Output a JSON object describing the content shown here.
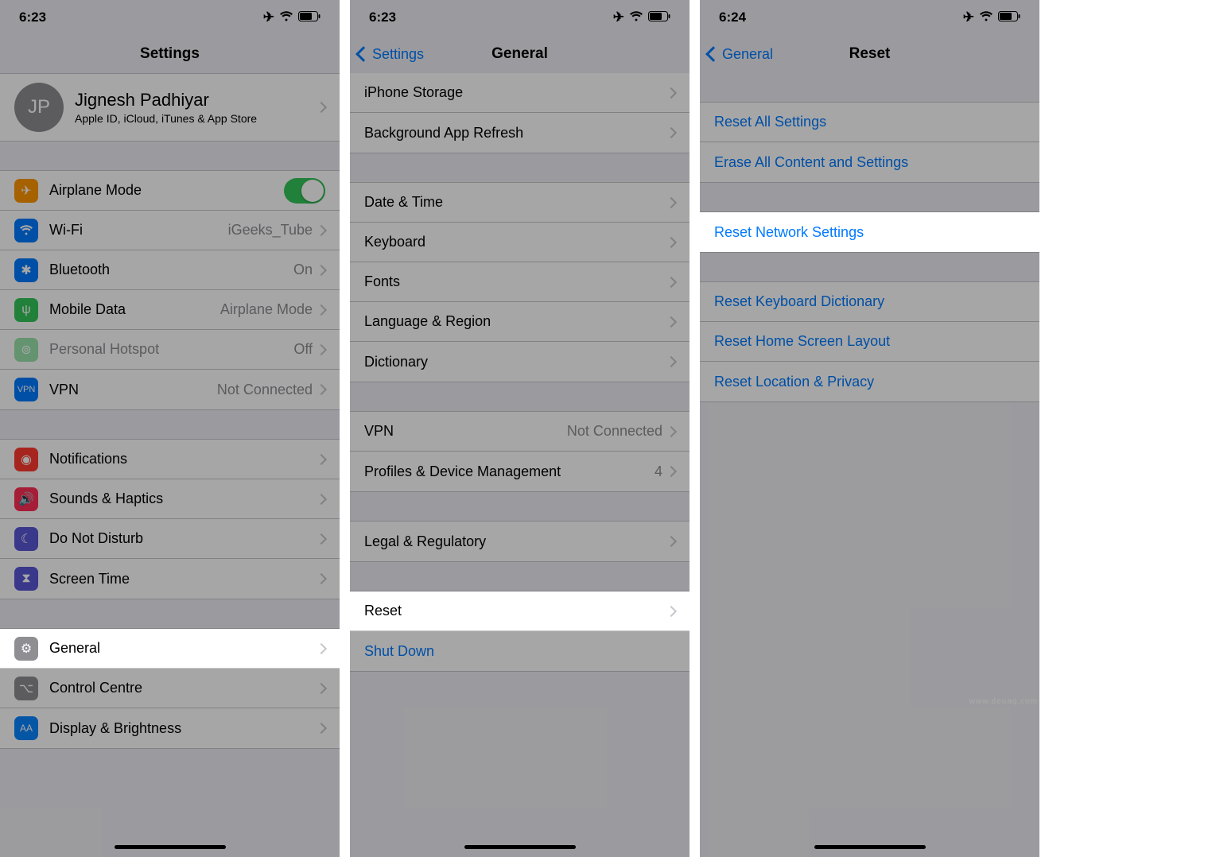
{
  "screen1": {
    "time": "6:23",
    "title": "Settings",
    "profile": {
      "initials": "JP",
      "name": "Jignesh Padhiyar",
      "sub": "Apple ID, iCloud, iTunes & App Store"
    },
    "airplane": "Airplane Mode",
    "wifi": {
      "label": "Wi-Fi",
      "value": "iGeeks_Tube"
    },
    "bluetooth": {
      "label": "Bluetooth",
      "value": "On"
    },
    "mobiledata": {
      "label": "Mobile Data",
      "value": "Airplane Mode"
    },
    "hotspot": {
      "label": "Personal Hotspot",
      "value": "Off"
    },
    "vpn": {
      "label": "VPN",
      "value": "Not Connected"
    },
    "notifications": "Notifications",
    "sounds": "Sounds & Haptics",
    "dnd": "Do Not Disturb",
    "screentime": "Screen Time",
    "general": "General",
    "controlcentre": "Control Centre",
    "display": "Display & Brightness"
  },
  "screen2": {
    "time": "6:23",
    "back": "Settings",
    "title": "General",
    "iphonestorage": "iPhone Storage",
    "bgrefresh": "Background App Refresh",
    "datetime": "Date & Time",
    "keyboard": "Keyboard",
    "fonts": "Fonts",
    "language": "Language & Region",
    "dictionary": "Dictionary",
    "vpn": {
      "label": "VPN",
      "value": "Not Connected"
    },
    "profiles": {
      "label": "Profiles & Device Management",
      "value": "4"
    },
    "legal": "Legal & Regulatory",
    "reset": "Reset",
    "shutdown": "Shut Down"
  },
  "screen3": {
    "time": "6:24",
    "back": "General",
    "title": "Reset",
    "resetall": "Reset All Settings",
    "erase": "Erase All Content and Settings",
    "resetnetwork": "Reset Network Settings",
    "resetkeyboard": "Reset Keyboard Dictionary",
    "resethome": "Reset Home Screen Layout",
    "resetlocation": "Reset Location & Privacy"
  },
  "watermark": "www.deuaq.com"
}
